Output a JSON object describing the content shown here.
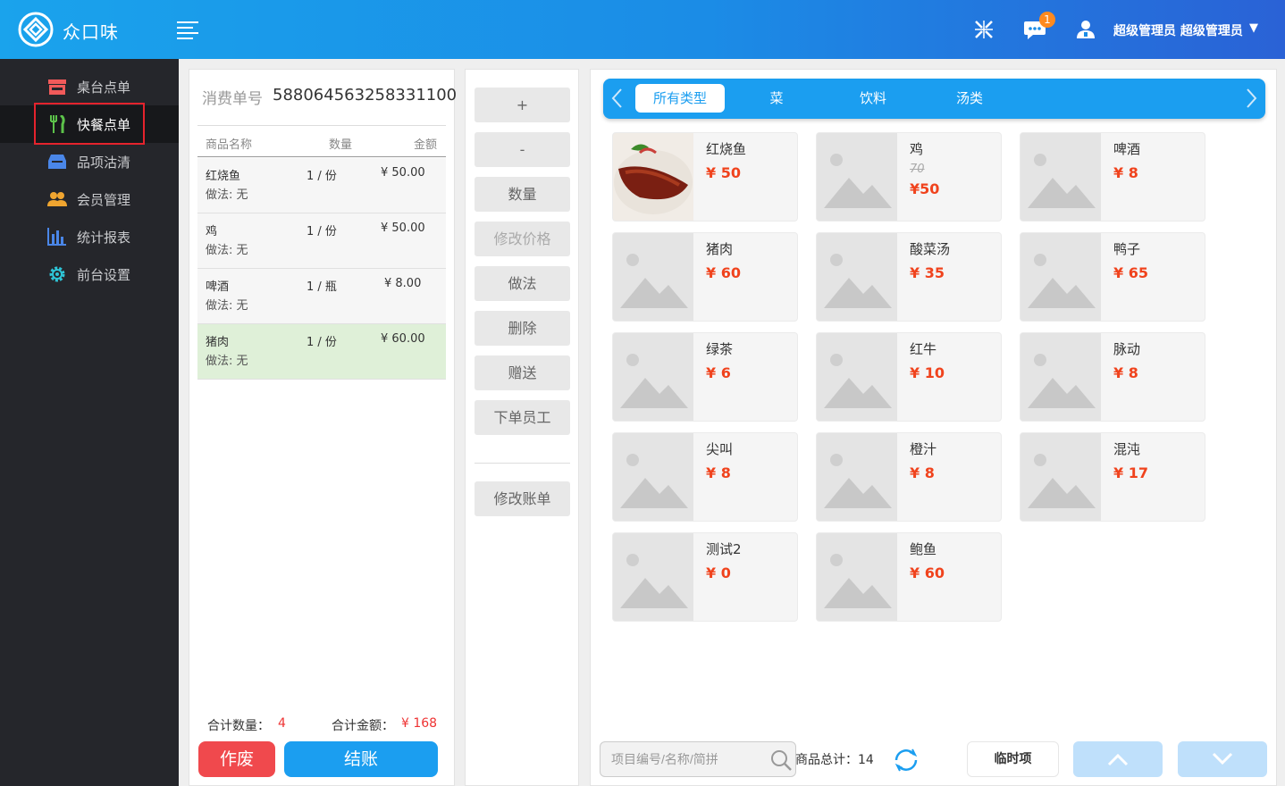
{
  "header": {
    "app_title": "众口味",
    "notification_count": "1",
    "user_name": "超级管理员 超级管理员",
    "user_caret": "▼",
    "icons": [
      "logo-icon",
      "menu-icon",
      "fullscreen-icon",
      "chat-icon",
      "user-icon"
    ]
  },
  "sidebar": {
    "items": [
      {
        "label": "桌台点单",
        "icon": "store-icon",
        "color": "#f15a5a"
      },
      {
        "label": "快餐点单",
        "icon": "utensils-icon",
        "color": "#5cc24a",
        "active": true
      },
      {
        "label": "品项沽清",
        "icon": "inbox-icon",
        "color": "#4a86e8"
      },
      {
        "label": "会员管理",
        "icon": "members-icon",
        "color": "#f0a530"
      },
      {
        "label": "统计报表",
        "icon": "bar-chart-icon",
        "color": "#4a86e8"
      },
      {
        "label": "前台设置",
        "icon": "gear-icon",
        "color": "#2ec4d6"
      }
    ]
  },
  "order": {
    "order_no_label": "消费单号",
    "order_no": "588064563258331100",
    "headers": {
      "name": "商品名称",
      "qty": "数量",
      "amount": "金额"
    },
    "rows": [
      {
        "name": "红烧鱼",
        "method": "做法: 无",
        "qty": "1 / 份",
        "amount": "¥ 50.00"
      },
      {
        "name": "鸡",
        "method": "做法: 无",
        "qty": "1 / 份",
        "amount": "¥ 50.00"
      },
      {
        "name": "啤酒",
        "method": "做法: 无",
        "qty": "1 / 瓶",
        "amount": "¥ 8.00"
      },
      {
        "name": "猪肉",
        "method": "做法: 无",
        "qty": "1 / 份",
        "amount": "¥ 60.00",
        "selected": true
      }
    ],
    "total_qty_label": "合计数量：",
    "total_qty": "4",
    "total_amount_label": "合计金额：",
    "total_amount": "¥ 168",
    "void_label": "作废",
    "checkout_label": "结账",
    "void_color": "#f0494d",
    "checkout_color": "#1b9ef0"
  },
  "actions": {
    "plus": "+",
    "minus": "-",
    "quantity": "数量",
    "edit_price": "修改价格",
    "method": "做法",
    "delete": "删除",
    "gift": "赠送",
    "staff": "下单员工",
    "edit_bill": "修改账单"
  },
  "categories": {
    "tabs": [
      "所有类型",
      "菜",
      "饮料",
      "汤类"
    ],
    "active_index": 0,
    "accent": "#1b9ef0"
  },
  "products": [
    {
      "name": "红烧鱼",
      "price": "¥ 50",
      "photo": true
    },
    {
      "name": "鸡",
      "old_price": "70",
      "price": "¥50"
    },
    {
      "name": "啤酒",
      "price": "¥ 8"
    },
    {
      "name": "猪肉",
      "price": "¥ 60"
    },
    {
      "name": "酸菜汤",
      "price": "¥ 35"
    },
    {
      "name": "鸭子",
      "price": "¥ 65"
    },
    {
      "name": "绿茶",
      "price": "¥ 6"
    },
    {
      "name": "红牛",
      "price": "¥ 10"
    },
    {
      "name": "脉动",
      "price": "¥ 8"
    },
    {
      "name": "尖叫",
      "price": "¥ 8"
    },
    {
      "name": "橙汁",
      "price": "¥ 8"
    },
    {
      "name": "混沌",
      "price": "¥ 17"
    },
    {
      "name": "测试2",
      "price": "¥ 0"
    },
    {
      "name": "鲍鱼",
      "price": "¥ 60"
    }
  ],
  "footer": {
    "search_placeholder": "项目编号/名称/简拼",
    "total_label": "商品总计：14",
    "temp_item_label": "临时项",
    "price_color": "#f0431d"
  }
}
